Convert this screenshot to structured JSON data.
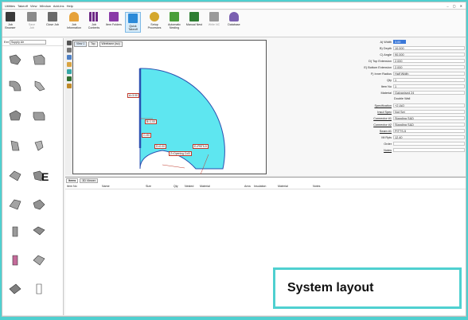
{
  "menubar": {
    "items": [
      "Utilities",
      "Takeoff",
      "View",
      "Window",
      "Add-Ins",
      "Help"
    ],
    "window_controls": "– ▢ ✕"
  },
  "ribbon": {
    "buttons": [
      {
        "label": "Job Browser",
        "icon": "job-browser-icon",
        "color": "#3a3a3a"
      },
      {
        "label": "Save Job",
        "icon": "save-icon",
        "color": "#8a8a8a"
      },
      {
        "label": "Close Job",
        "icon": "close-job-icon",
        "color": "#6a6a6a"
      },
      {
        "label": "Job Information",
        "icon": "person-icon",
        "color": "#e6a23a"
      },
      {
        "label": "Job Contents",
        "icon": "grid-icon",
        "color": "#6e2a86"
      },
      {
        "label": "Item Folders",
        "icon": "folders-icon",
        "color": "#8a3aa8"
      },
      {
        "label": "Quick Takeoff",
        "icon": "quick-takeoff-icon",
        "color": "#2b8ad8"
      },
      {
        "label": "Setup Processes",
        "icon": "setup-icon",
        "color": "#d4a72c"
      },
      {
        "label": "Automatic Nesting",
        "icon": "nesting-icon",
        "color": "#4a9e3a"
      },
      {
        "label": "Manual Nest",
        "icon": "manual-nest-icon",
        "color": "#2e7d32"
      },
      {
        "label": "Write NC",
        "icon": "write-nc-icon",
        "color": "#9a9a9a"
      },
      {
        "label": "Database",
        "icon": "database-icon",
        "color": "#7a5fb0"
      }
    ]
  },
  "leftpanel": {
    "label": "Ext",
    "select_value": "Supply Air",
    "overlay_letter": "E"
  },
  "view": {
    "tabs": [
      "View 1",
      "Top",
      "Wireframe (iso)"
    ],
    "dims": {
      "a": "A=3.00",
      "b": "B=1.00",
      "c": "C=90",
      "d": "D=0.00",
      "r": "Y=0.00",
      "ext": "E=PBT5-5",
      "z": "Z=Opening Col0"
    }
  },
  "props": {
    "rows": [
      {
        "label": "A) Width",
        "value": "3.00",
        "highlight": true
      },
      {
        "label": "B) Depth",
        "value": "10.000"
      },
      {
        "label": "C) Angle",
        "value": "90.000"
      },
      {
        "label": "D) Top Extension",
        "value": "2.000"
      },
      {
        "label": "E) Bottom Extension",
        "value": "2.000"
      },
      {
        "label": "F) Inner Radius",
        "value": "Half Width"
      },
      {
        "label": "Qty",
        "value": "1"
      },
      {
        "label": "Item No",
        "value": "1"
      },
      {
        "label": "Material",
        "value": "Galvanised                        24"
      },
      {
        "label": "",
        "value": "Double Wall"
      },
      {
        "label": "Specification",
        "value": "+2 IAQ",
        "link": true
      },
      {
        "label": "Insul Spec",
        "value": "Not Set",
        "link": true
      },
      {
        "label": "Connector #1",
        "value": "Standing S&D",
        "link": true
      },
      {
        "label": "Connector #2",
        "value": "Standing S&D",
        "link": true
      },
      {
        "label": "Seam #1",
        "value": "PITTS-5",
        "link": true
      },
      {
        "label": "Mi Ryts",
        "value": "                                   12.40"
      },
      {
        "label": "Order",
        "value": ""
      },
      {
        "label": "Notes",
        "value": "",
        "link": true
      }
    ]
  },
  "table": {
    "tabs": [
      "Items",
      "3D Viewer"
    ],
    "headers": [
      "Item No",
      "Name",
      "Size",
      "Qty",
      "Nested",
      "Material",
      "Area",
      "Insulation",
      "Material",
      "Notes"
    ]
  },
  "callout": {
    "text": "System layout"
  },
  "colors": {
    "frame": "#4fd0d0",
    "elbow": "#5ee6f0",
    "highlight": "#3b78d8"
  }
}
